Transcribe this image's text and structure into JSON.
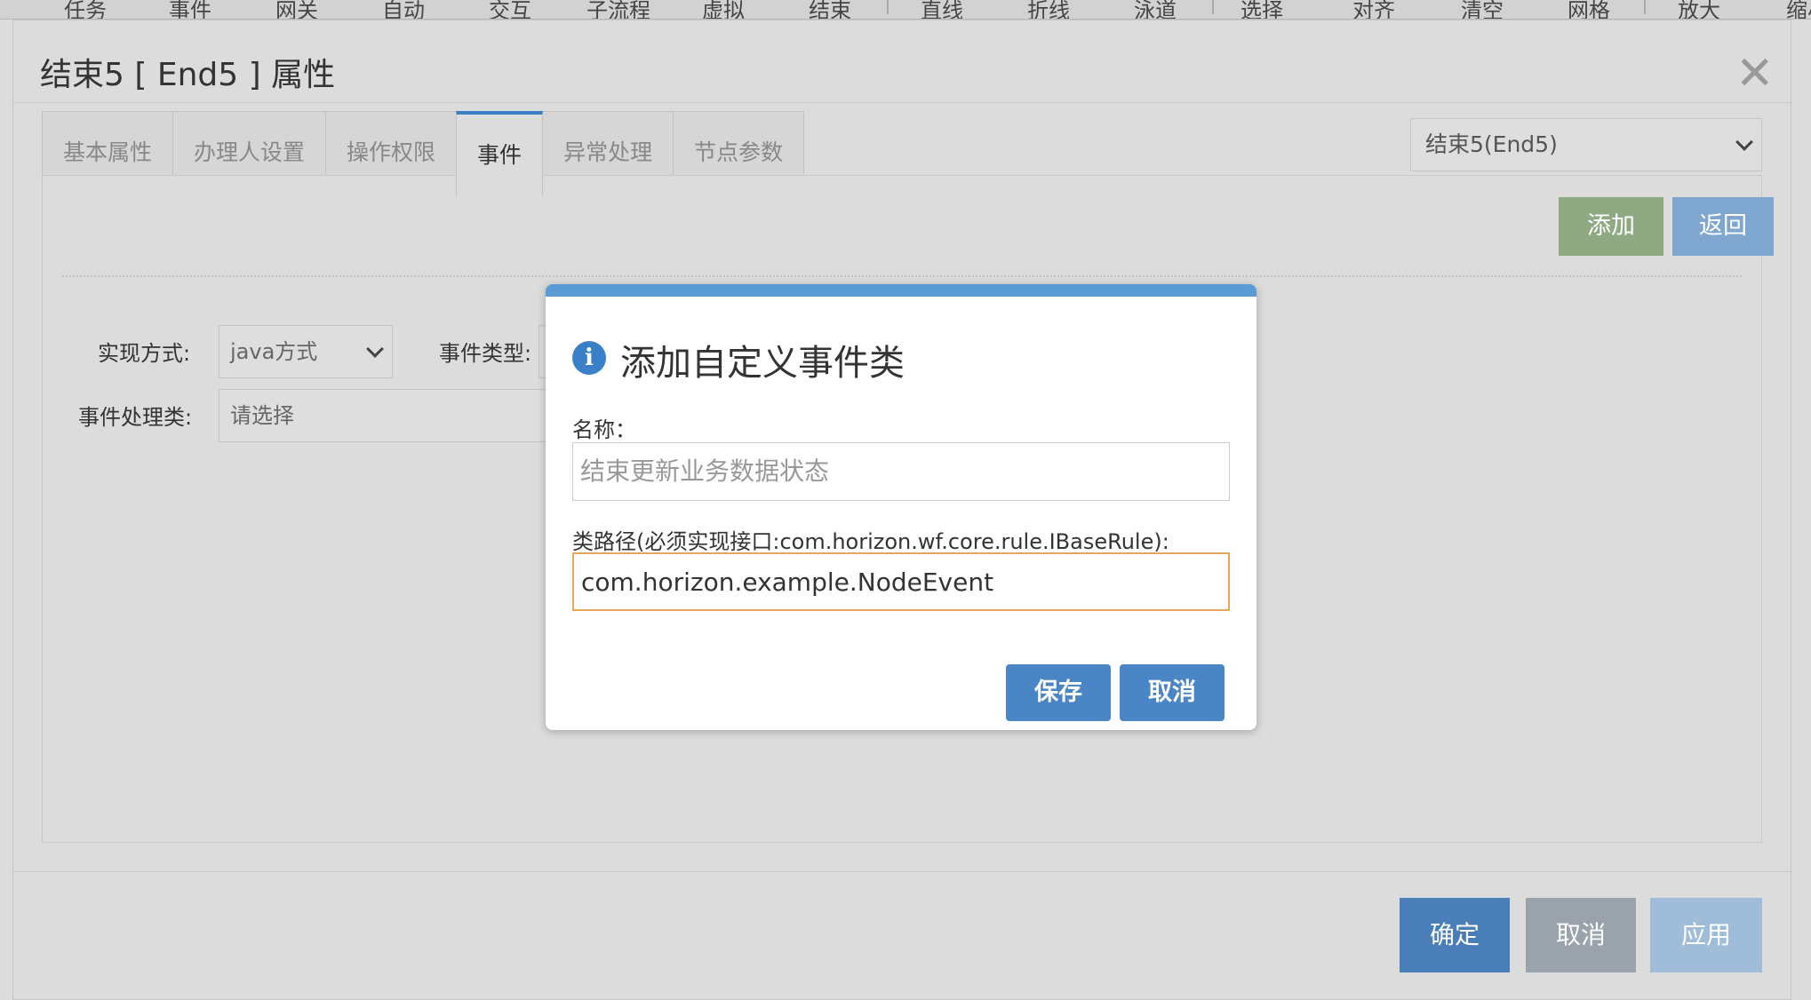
{
  "toolbar": {
    "items": [
      "任务",
      "事件",
      "网关",
      "自动",
      "交互",
      "子流程",
      "虚拟",
      "结束",
      "直线",
      "折线",
      "泳道",
      "选择",
      "对齐",
      "清空",
      "网格",
      "放大",
      "缩小"
    ]
  },
  "window": {
    "title": "结束5 [ End5 ] 属性",
    "close_glyph": "✕",
    "tabs": [
      "基本属性",
      "办理人设置",
      "操作权限",
      "事件",
      "异常处理",
      "节点参数"
    ],
    "active_tab": "事件",
    "node_select_value": "结束5(End5)"
  },
  "events_panel": {
    "add_label": "添加",
    "back_label": "返回",
    "impl_label": "实现方式:",
    "impl_value": "java方式",
    "event_type_label": "事件类型:",
    "event_type_value": "",
    "handler_label": "事件处理类:",
    "handler_value": "请选择"
  },
  "footer": {
    "ok_label": "确定",
    "cancel_label": "取消",
    "apply_label": "应用"
  },
  "modal": {
    "icon_glyph": "i",
    "title": "添加自定义事件类",
    "name_label": "名称：",
    "name_placeholder": "结束更新业务数据状态",
    "classpath_label": "类路径(必须实现接口:com.horizon.wf.core.rule.IBaseRule):",
    "classpath_value": "com.horizon.example.NodeEvent",
    "save_label": "保存",
    "cancel_label": "取消"
  },
  "colors": {
    "accent": "#4a86c6",
    "modal_bar": "#5b9bd5",
    "add_button": "#8faa83",
    "focus_border": "#e8a65a"
  }
}
